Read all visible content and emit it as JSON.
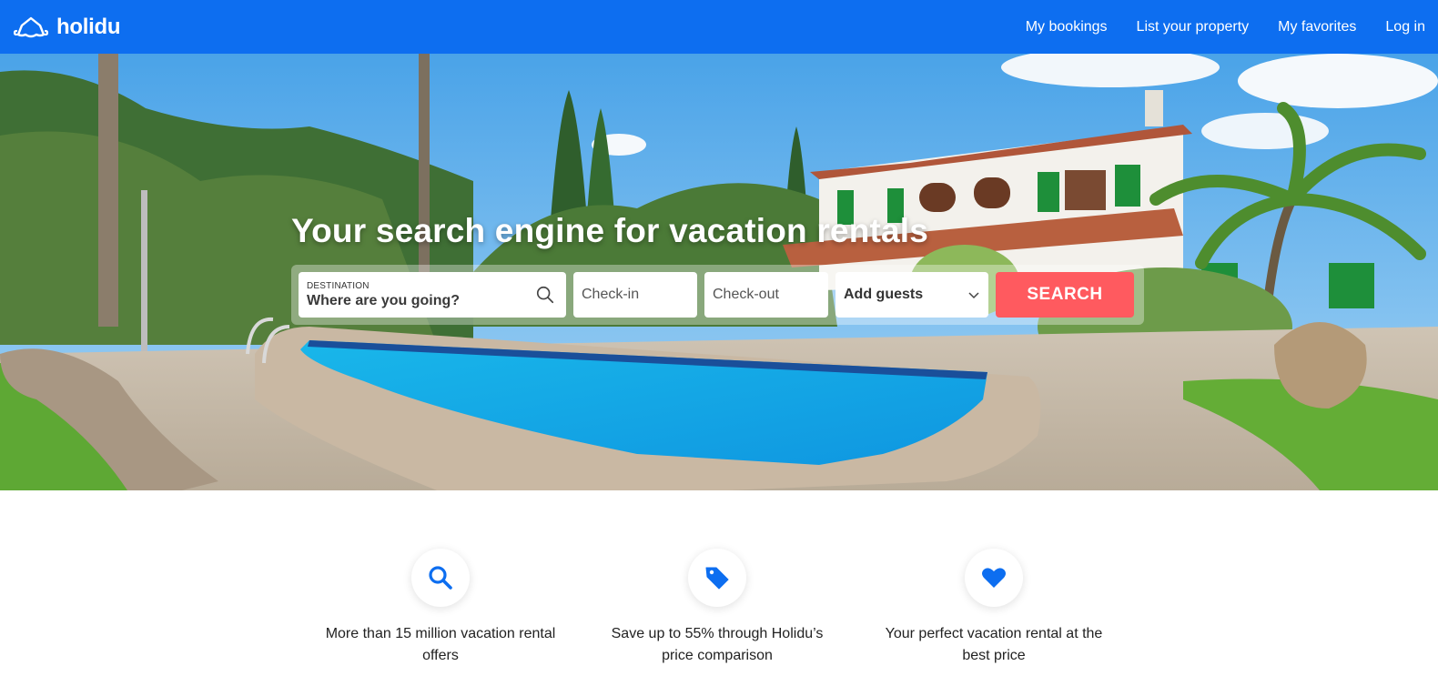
{
  "header": {
    "logo_text": "holidu",
    "nav": [
      "My bookings",
      "List your property",
      "My favorites",
      "Log in"
    ]
  },
  "hero": {
    "title": "Your search engine for vacation rentals"
  },
  "search": {
    "destination_label": "DESTINATION",
    "destination_placeholder": "Where are you going?",
    "checkin_placeholder": "Check-in",
    "checkout_placeholder": "Check-out",
    "guests_label": "Add guests",
    "button_label": "SEARCH"
  },
  "features": [
    {
      "icon": "search-icon",
      "text": "More than 15 million vacation rental offers"
    },
    {
      "icon": "price-tag-icon",
      "text": "Save up to 55% through Holidu’s price comparison"
    },
    {
      "icon": "heart-icon",
      "text": "Your perfect vacation rental at the best price"
    }
  ],
  "colors": {
    "brand_blue": "#0d6ef0",
    "search_button": "#ff5a5f",
    "icon_blue": "#0d6ef0"
  }
}
